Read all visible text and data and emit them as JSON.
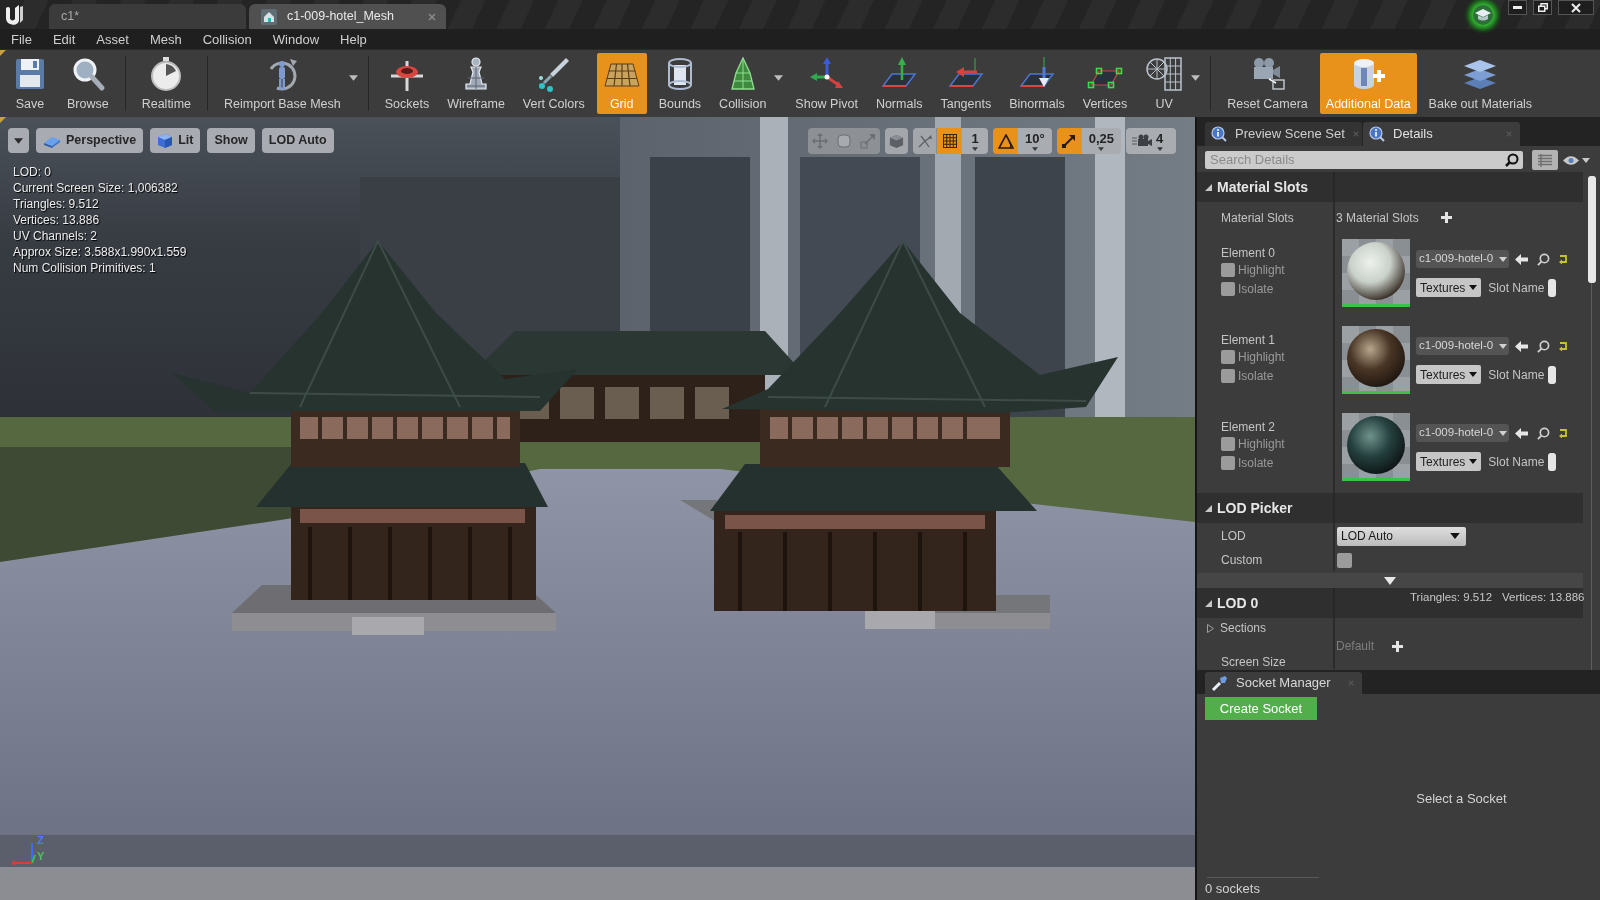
{
  "window": {
    "tabs": [
      {
        "label": "c1*",
        "selected": false
      },
      {
        "label": "c1-009-hotel_Mesh",
        "selected": true
      }
    ]
  },
  "menu": [
    "File",
    "Edit",
    "Asset",
    "Mesh",
    "Collision",
    "Window",
    "Help"
  ],
  "toolbar": {
    "groups": [
      {
        "buttons": [
          {
            "label": "Save",
            "on": false,
            "dropdown": false
          },
          {
            "label": "Browse",
            "on": false,
            "dropdown": false
          }
        ]
      },
      {
        "buttons": [
          {
            "label": "Realtime",
            "on": false,
            "dropdown": false
          }
        ]
      },
      {
        "buttons": [
          {
            "label": "Reimport Base Mesh",
            "on": false,
            "dropdown": true
          }
        ]
      },
      {
        "buttons": [
          {
            "label": "Sockets",
            "on": false,
            "dropdown": false
          },
          {
            "label": "Wireframe",
            "on": false,
            "dropdown": false
          },
          {
            "label": "Vert Colors",
            "on": false,
            "dropdown": false
          },
          {
            "label": "Grid",
            "on": true,
            "dropdown": false
          },
          {
            "label": "Bounds",
            "on": false,
            "dropdown": false
          },
          {
            "label": "Collision",
            "on": false,
            "dropdown": true
          },
          {
            "label": "Show Pivot",
            "on": false,
            "dropdown": false
          },
          {
            "label": "Normals",
            "on": false,
            "dropdown": false
          },
          {
            "label": "Tangents",
            "on": false,
            "dropdown": false
          },
          {
            "label": "Binormals",
            "on": false,
            "dropdown": false
          },
          {
            "label": "Vertices",
            "on": false,
            "dropdown": false
          },
          {
            "label": "UV",
            "on": false,
            "dropdown": true
          }
        ]
      },
      {
        "buttons": [
          {
            "label": "Reset Camera",
            "on": false,
            "dropdown": false
          },
          {
            "label": "Additional Data",
            "on": true,
            "dropdown": false
          },
          {
            "label": "Bake out Materials",
            "on": false,
            "dropdown": false
          }
        ]
      }
    ]
  },
  "viewport": {
    "view_buttons": [
      "Perspective",
      "Lit",
      "Show",
      "LOD Auto"
    ],
    "stats": [
      "LOD: 0",
      "Current Screen Size: 1,006382",
      "Triangles: 9.512",
      "Vertices: 13.886",
      "UV Channels: 2",
      "Approx Size: 3.588x1.990x1.559",
      "Num Collision Primitives: 1"
    ],
    "snapping": [
      {
        "value": "1",
        "on": true
      },
      {
        "value": "10°",
        "on": true
      },
      {
        "value": "0,25",
        "on": true
      }
    ],
    "camera_speed": "4",
    "axis_labels": [
      "Z",
      "Y"
    ]
  },
  "details": {
    "tabs": [
      {
        "label": "Preview Scene Set",
        "selected": false
      },
      {
        "label": "Details",
        "selected": true
      }
    ],
    "search": {
      "placeholder": "Search Details"
    },
    "sections": [
      {
        "kind": "material_slots",
        "title": "Material Slots",
        "expanded": true,
        "label": "Material Slots",
        "count": "3 Material Slots",
        "elements": [
          {
            "name": "Element 0",
            "checkboxes": [
              {
                "label": "Highlight",
                "checked": false
              },
              {
                "label": "Isolate",
                "checked": false
              }
            ],
            "material": "c1-009-hotel-0",
            "textures": "Textures",
            "slot_label": "Slot Name"
          },
          {
            "name": "Element 1",
            "checkboxes": [
              {
                "label": "Highlight",
                "checked": false
              },
              {
                "label": "Isolate",
                "checked": false
              }
            ],
            "material": "c1-009-hotel-0",
            "textures": "Textures",
            "slot_label": "Slot Name"
          },
          {
            "name": "Element 2",
            "checkboxes": [
              {
                "label": "Highlight",
                "checked": false
              },
              {
                "label": "Isolate",
                "checked": false
              }
            ],
            "material": "c1-009-hotel-0",
            "textures": "Textures",
            "slot_label": "Slot Name"
          }
        ]
      },
      {
        "kind": "lod_picker",
        "title": "LOD Picker",
        "expanded": true,
        "rows": [
          {
            "kind": "dropdown",
            "label": "LOD",
            "value": "LOD Auto"
          },
          {
            "kind": "checkbox",
            "label": "Custom",
            "checked": false
          }
        ]
      },
      {
        "kind": "lod",
        "title": "LOD 0",
        "expanded": true,
        "info": [
          "Triangles: 9.512",
          "Vertices: 13.886"
        ],
        "rows": [
          {
            "kind": "group",
            "label": "Sections",
            "expanded": false
          },
          {
            "kind": "add",
            "value": "Default"
          },
          {
            "kind": "label",
            "label": "Screen Size"
          }
        ]
      }
    ]
  },
  "socket_manager": {
    "tab": "Socket Manager",
    "button": "Create Socket",
    "empty_text": "Select a Socket",
    "count": "0 sockets"
  }
}
